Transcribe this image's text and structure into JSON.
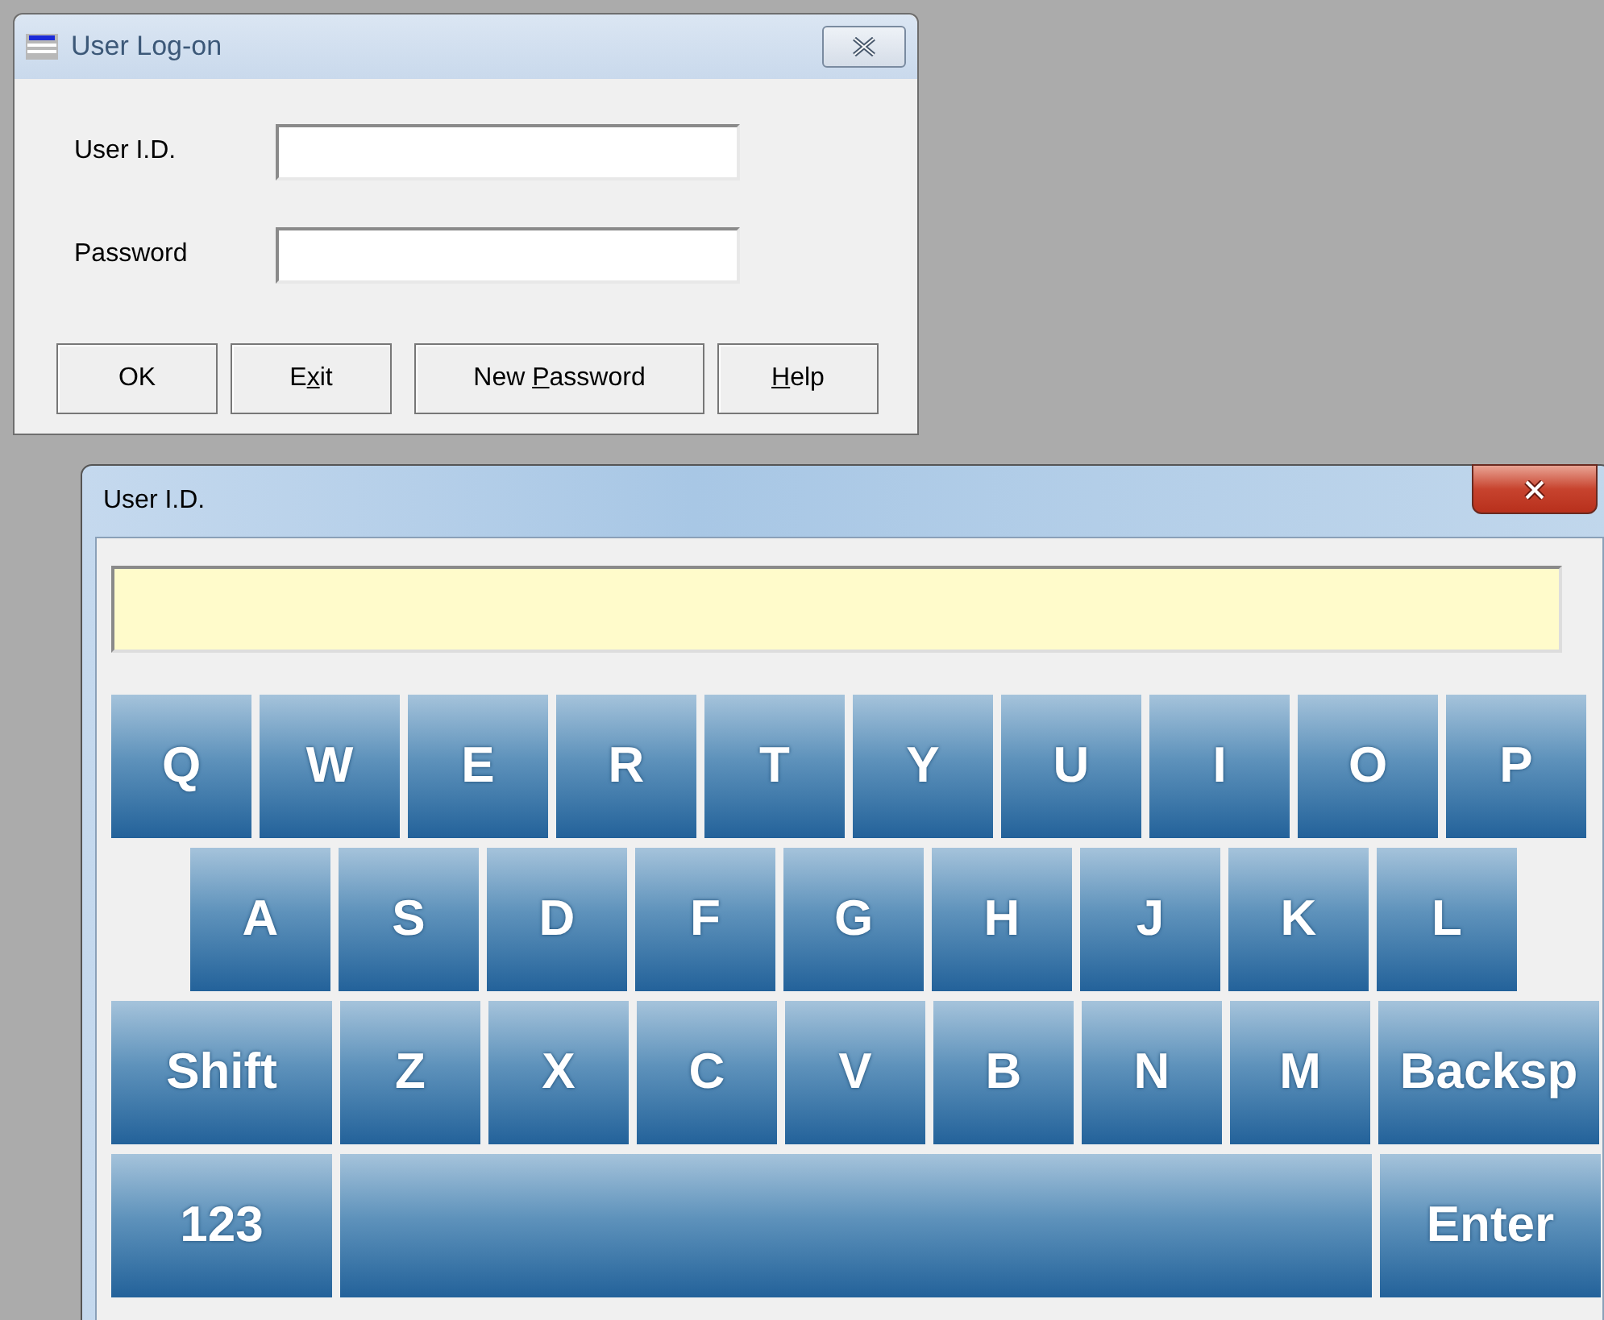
{
  "logon_window": {
    "title": "User Log-on",
    "fields": [
      {
        "label": "User I.D."
      },
      {
        "label": "Password"
      }
    ],
    "buttons": [
      {
        "pre": "OK"
      },
      {
        "pre": "E",
        "key": "x",
        "post": "it"
      },
      {
        "pre": "New ",
        "key": "P",
        "post": "assword"
      },
      {
        "key": "H",
        "post": "elp"
      }
    ]
  },
  "keyboard_window": {
    "title": "User I.D.",
    "key_rows": [
      {
        "keys": [
          {
            "kind": "letter",
            "label": "Q"
          },
          {
            "kind": "letter",
            "label": "W"
          },
          {
            "kind": "letter",
            "label": "E"
          },
          {
            "kind": "letter",
            "label": "R"
          },
          {
            "kind": "letter",
            "label": "T"
          },
          {
            "kind": "letter",
            "label": "Y"
          },
          {
            "kind": "letter",
            "label": "U"
          },
          {
            "kind": "letter",
            "label": "I"
          },
          {
            "kind": "letter",
            "label": "O"
          },
          {
            "kind": "letter",
            "label": "P"
          }
        ]
      },
      {
        "keys": [
          {
            "kind": "letter",
            "label": "A"
          },
          {
            "kind": "letter",
            "label": "S"
          },
          {
            "kind": "letter",
            "label": "D"
          },
          {
            "kind": "letter",
            "label": "F"
          },
          {
            "kind": "letter",
            "label": "G"
          },
          {
            "kind": "letter",
            "label": "H"
          },
          {
            "kind": "letter",
            "label": "J"
          },
          {
            "kind": "letter",
            "label": "K"
          },
          {
            "kind": "letter",
            "label": "L"
          }
        ]
      },
      {
        "keys": [
          {
            "kind": "wide",
            "label": "Shift"
          },
          {
            "kind": "letter",
            "label": "Z"
          },
          {
            "kind": "letter",
            "label": "X"
          },
          {
            "kind": "letter",
            "label": "C"
          },
          {
            "kind": "letter",
            "label": "V"
          },
          {
            "kind": "letter",
            "label": "B"
          },
          {
            "kind": "letter",
            "label": "N"
          },
          {
            "kind": "letter",
            "label": "M"
          },
          {
            "kind": "wide",
            "label": "Backsp"
          }
        ]
      },
      {
        "keys": [
          {
            "kind": "wide",
            "label": "123"
          },
          {
            "kind": "space"
          },
          {
            "kind": "wide",
            "label": "Enter"
          }
        ]
      }
    ]
  }
}
